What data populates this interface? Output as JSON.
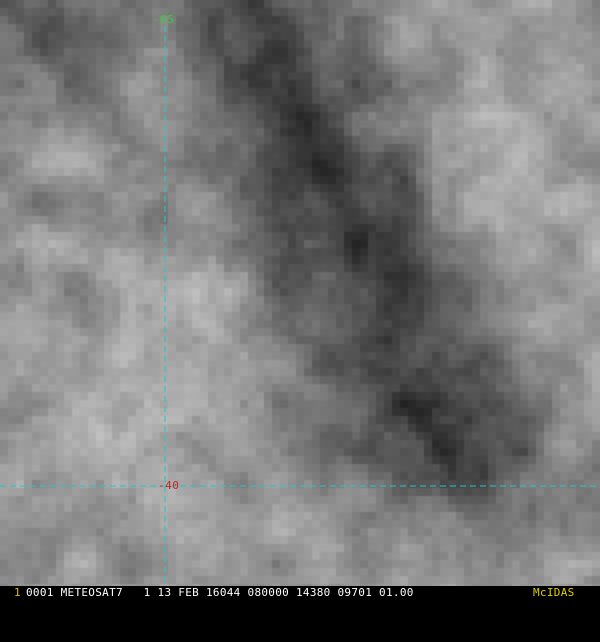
{
  "image": {
    "type": "satellite-infrared",
    "palette": "grayscale"
  },
  "grid": {
    "line_color": "#1fc8c8",
    "longitude_label": "-65",
    "longitude_label_color": "#33cc33",
    "latitude_label": "-40",
    "latitude_label_color": "#cc2222"
  },
  "status_bar": {
    "frame_number": "1",
    "frame_color": "#e0c000",
    "info": "0001 METEOSAT7   1 13 FEB 16044 080000 14380 09701 01.00",
    "info_color": "#ffffff",
    "brand": "McIDAS",
    "brand_color": "#e0d000"
  }
}
